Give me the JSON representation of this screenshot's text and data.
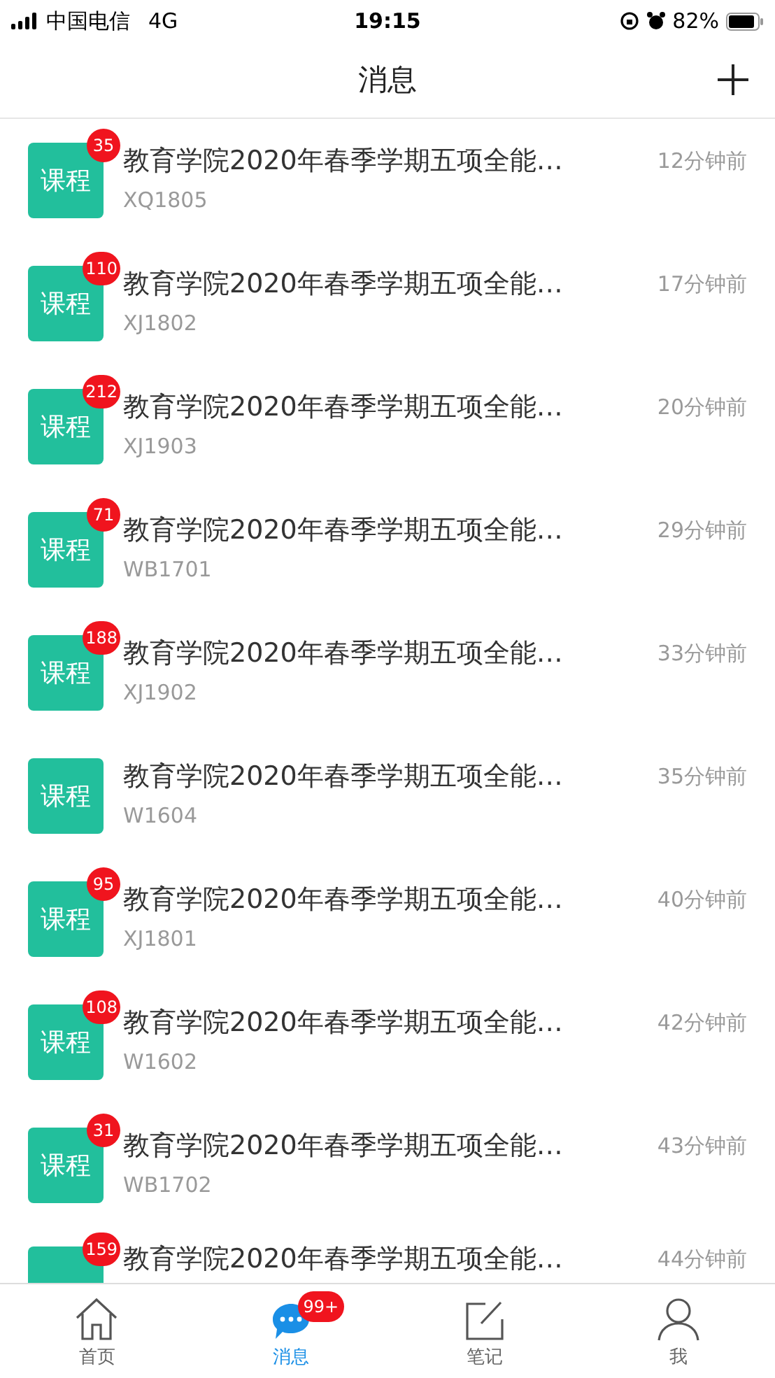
{
  "status_bar": {
    "carrier": "中国电信",
    "network": "4G",
    "time": "19:15",
    "battery": "82%"
  },
  "header": {
    "title": "消息"
  },
  "messages": [
    {
      "icon_label": "课程",
      "badge": "35",
      "title": "教育学院2020年春季学期五项全能…",
      "code": "XQ1805",
      "time": "12分钟前"
    },
    {
      "icon_label": "课程",
      "badge": "110",
      "title": "教育学院2020年春季学期五项全能…",
      "code": "XJ1802",
      "time": "17分钟前"
    },
    {
      "icon_label": "课程",
      "badge": "212",
      "title": "教育学院2020年春季学期五项全能…",
      "code": "XJ1903",
      "time": "20分钟前"
    },
    {
      "icon_label": "课程",
      "badge": "71",
      "title": "教育学院2020年春季学期五项全能…",
      "code": "WB1701",
      "time": "29分钟前"
    },
    {
      "icon_label": "课程",
      "badge": "188",
      "title": "教育学院2020年春季学期五项全能…",
      "code": "XJ1902",
      "time": "33分钟前"
    },
    {
      "icon_label": "课程",
      "title": "教育学院2020年春季学期五项全能…",
      "code": "W1604",
      "time": "35分钟前"
    },
    {
      "icon_label": "课程",
      "badge": "95",
      "title": "教育学院2020年春季学期五项全能…",
      "code": "XJ1801",
      "time": "40分钟前"
    },
    {
      "icon_label": "课程",
      "badge": "108",
      "title": "教育学院2020年春季学期五项全能…",
      "code": "W1602",
      "time": "42分钟前"
    },
    {
      "icon_label": "课程",
      "badge": "31",
      "title": "教育学院2020年春季学期五项全能…",
      "code": "WB1702",
      "time": "43分钟前"
    },
    {
      "badge": "159",
      "title": "教育学院2020年春季学期五项全能…",
      "time": "44分钟前"
    }
  ],
  "tab_bar": [
    {
      "kind": "home",
      "label": "首页",
      "selected": false
    },
    {
      "kind": "chat",
      "label": "消息",
      "selected": true,
      "badge": "99+"
    },
    {
      "kind": "note",
      "label": "笔记",
      "selected": false
    },
    {
      "kind": "user",
      "label": "我",
      "selected": false
    }
  ]
}
